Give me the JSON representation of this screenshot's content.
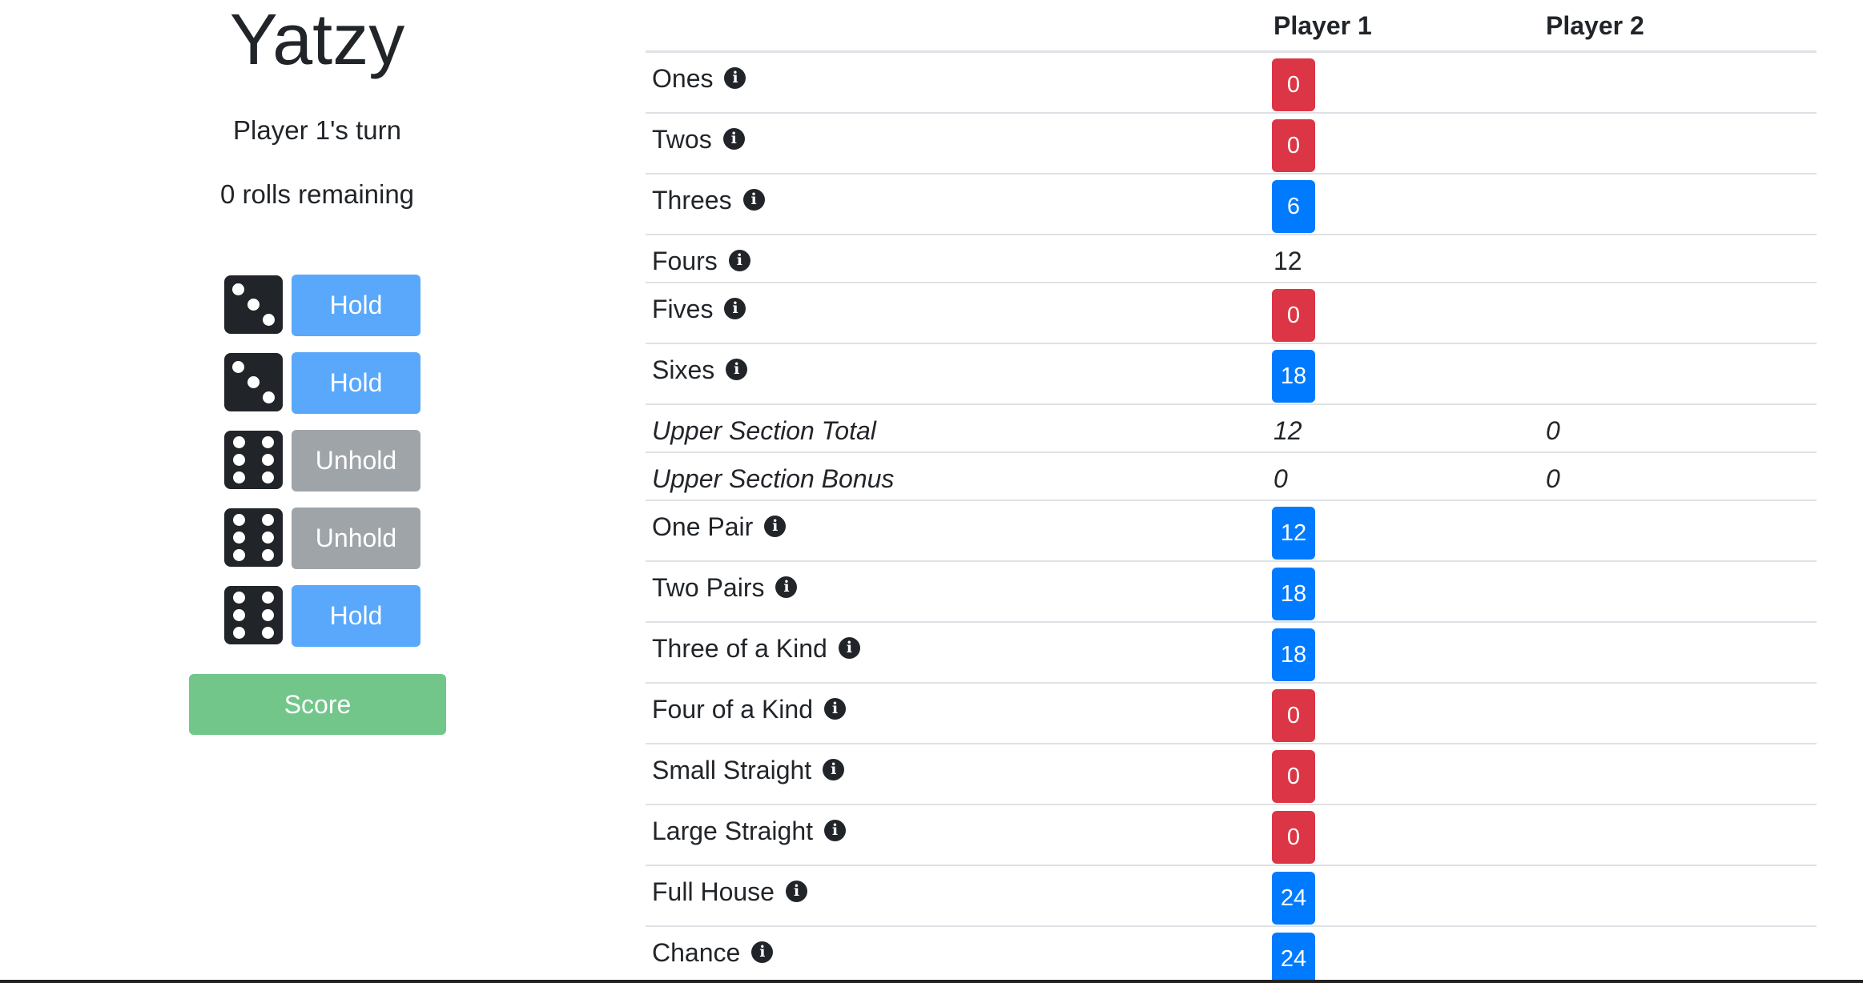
{
  "app": {
    "title": "Yatzy",
    "turn_text": "Player 1's turn",
    "rolls_text": "0 rolls remaining",
    "score_label": "Score"
  },
  "dice": [
    {
      "value": 3,
      "button": "Hold",
      "held": false
    },
    {
      "value": 3,
      "button": "Hold",
      "held": false
    },
    {
      "value": 6,
      "button": "Unhold",
      "held": true
    },
    {
      "value": 6,
      "button": "Unhold",
      "held": true
    },
    {
      "value": 6,
      "button": "Hold",
      "held": false
    }
  ],
  "table": {
    "headers": [
      "",
      "Player 1",
      "Player 2"
    ],
    "info_glyph": "i",
    "rows": [
      {
        "label": "Ones",
        "p1": "0",
        "style": "red",
        "info": true
      },
      {
        "label": "Twos",
        "p1": "0",
        "style": "red",
        "info": true
      },
      {
        "label": "Threes",
        "p1": "6",
        "style": "blue",
        "info": true
      },
      {
        "label": "Fours",
        "p1": "12",
        "style": "plain",
        "info": true
      },
      {
        "label": "Fives",
        "p1": "0",
        "style": "red",
        "info": true
      },
      {
        "label": "Sixes",
        "p1": "18",
        "style": "blue",
        "info": true
      },
      {
        "label": "Upper Section Total",
        "p1": "12",
        "p2": "0",
        "style": "total",
        "info": false
      },
      {
        "label": "Upper Section Bonus",
        "p1": "0",
        "p2": "0",
        "style": "total",
        "info": false
      },
      {
        "label": "One Pair",
        "p1": "12",
        "style": "blue",
        "info": true
      },
      {
        "label": "Two Pairs",
        "p1": "18",
        "style": "blue",
        "info": true
      },
      {
        "label": "Three of a Kind",
        "p1": "18",
        "style": "blue",
        "info": true
      },
      {
        "label": "Four of a Kind",
        "p1": "0",
        "style": "red",
        "info": true
      },
      {
        "label": "Small Straight",
        "p1": "0",
        "style": "red",
        "info": true
      },
      {
        "label": "Large Straight",
        "p1": "0",
        "style": "red",
        "info": true
      },
      {
        "label": "Full House",
        "p1": "24",
        "style": "blue",
        "info": true
      },
      {
        "label": "Chance",
        "p1": "24",
        "style": "blue",
        "info": true
      }
    ]
  },
  "colors": {
    "hold": "#5aa8fb",
    "unhold": "#9fa4a9",
    "score": "#72c68a",
    "badge_red": "#dc3545",
    "badge_blue": "#007bff"
  }
}
